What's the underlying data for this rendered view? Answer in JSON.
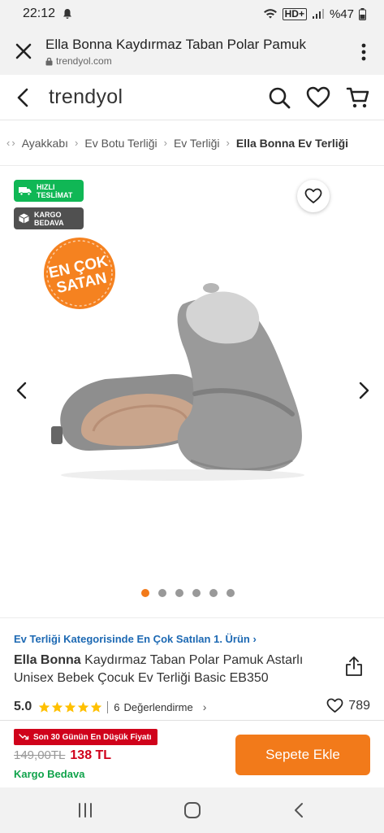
{
  "status": {
    "time": "22:12",
    "network": "HD+",
    "battery": "%47"
  },
  "browser": {
    "title": "Ella Bonna Kaydırmaz Taban Polar Pamuk",
    "url": "trendyol.com"
  },
  "header": {
    "logo": "trendyol"
  },
  "breadcrumb": {
    "items": [
      "Ayakkabı",
      "Ev Botu Terliği",
      "Ev Terliği",
      "Ella Bonna Ev Terliği"
    ]
  },
  "gallery": {
    "badges": {
      "fast_line1": "HIZLI",
      "fast_line2": "TESLİMAT",
      "cargo_line1": "KARGO",
      "cargo_line2": "BEDAVA"
    },
    "best_seller_line1": "EN ÇOK",
    "best_seller_line2": "SATAN",
    "dots": 6,
    "active_dot": 0,
    "accent": "#f27a1a"
  },
  "product": {
    "category_link": "Ev Terliği Kategorisinde En Çok Satılan 1. Ürün",
    "brand": "Ella Bonna",
    "title": "Kaydırmaz Taban Polar Pamuk Astarlı Unisex Bebek Çocuk Ev Terliği Basic EB350",
    "rating": "5.0",
    "stars": 5,
    "review_count": "6",
    "review_label": "Değerlendirme",
    "favorites": "789"
  },
  "buy": {
    "lowest_badge": "Son 30 Günün En Düşük Fiyatı",
    "old_price": "149,00TL",
    "new_price": "138 TL",
    "shipping": "Kargo Bedava",
    "add_to_cart": "Sepete Ekle",
    "colors": {
      "price_red": "#d0021b",
      "ship_green": "#10a34b",
      "button": "#f27a1a"
    }
  }
}
